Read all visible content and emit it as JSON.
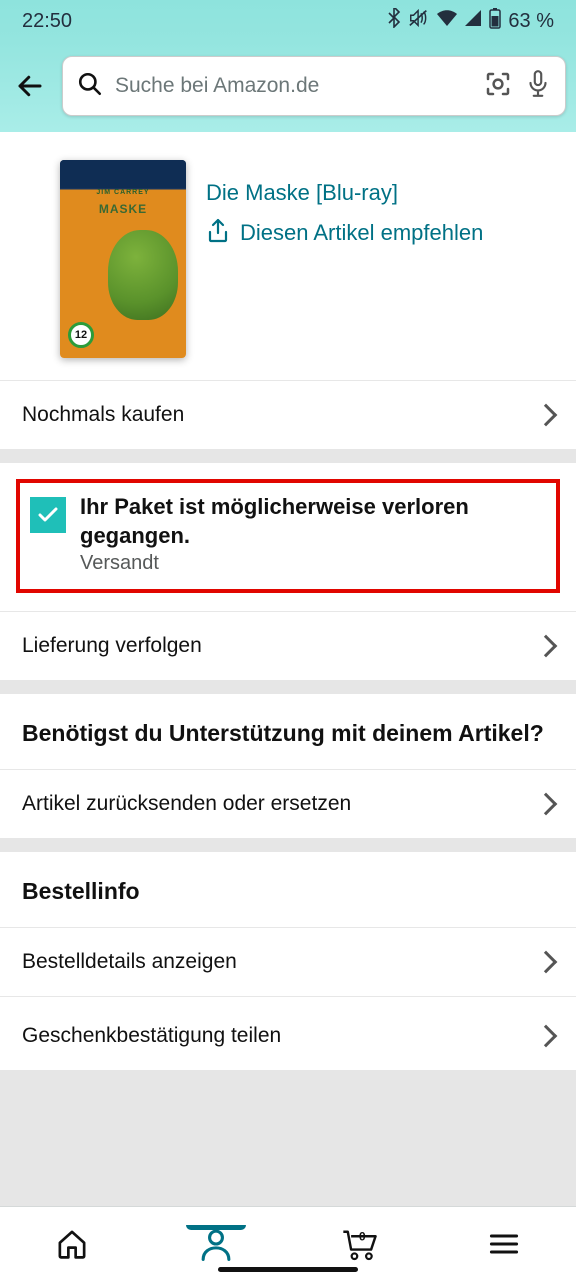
{
  "status_bar": {
    "time": "22:50",
    "battery": "63 %"
  },
  "search": {
    "placeholder": "Suche bei Amazon.de"
  },
  "product": {
    "title": "Die Maske [Blu-ray]",
    "share_label": "Diesen Artikel empfehlen",
    "thumb_actor": "JIM CARREY",
    "thumb_title": "MASKE",
    "age_rating": "12"
  },
  "actions": {
    "buy_again": "Nochmals kaufen",
    "track": "Lieferung verfolgen",
    "return": "Artikel zurücksenden oder ersetzen",
    "order_details": "Bestelldetails anzeigen",
    "gift_confirm": "Geschenkbestätigung teilen"
  },
  "status": {
    "title": "Ihr Paket ist möglicherweise verloren gegangen.",
    "sub": "Versandt"
  },
  "sections": {
    "help_title": "Benötigst du Unterstützung mit deinem Artikel?",
    "order_info": "Bestellinfo"
  },
  "nav": {
    "cart_count": "0"
  }
}
